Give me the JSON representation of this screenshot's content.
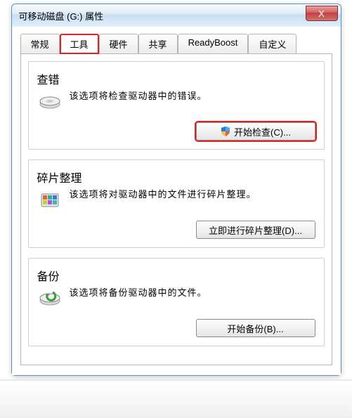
{
  "titlebar": {
    "title": "可移动磁盘 (G:) 属性",
    "close": "X"
  },
  "tabs": [
    {
      "label": "常规"
    },
    {
      "label": "工具"
    },
    {
      "label": "硬件"
    },
    {
      "label": "共享"
    },
    {
      "label": "ReadyBoost"
    },
    {
      "label": "自定义"
    }
  ],
  "groups": {
    "check": {
      "legend": "查错",
      "desc": "该选项将检查驱动器中的错误。",
      "btn": "开始检查(C)..."
    },
    "defrag": {
      "legend": "碎片整理",
      "desc": "该选项将对驱动器中的文件进行碎片整理。",
      "btn": "立即进行碎片整理(D)..."
    },
    "backup": {
      "legend": "备份",
      "desc": "该选项将备份驱动器中的文件。",
      "btn": "开始备份(B)..."
    }
  }
}
